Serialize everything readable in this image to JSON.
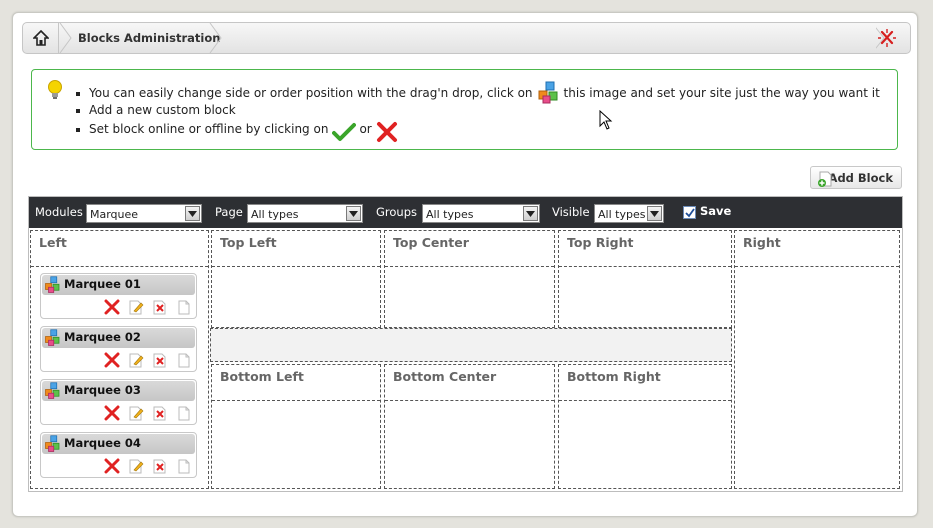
{
  "breadcrumb": {
    "title": "Blocks Administration",
    "home_icon": "home-icon",
    "close_icon": "close-icon"
  },
  "info": {
    "line1_a": "You can easily change side or order position with the drag'n drop, click on",
    "line1_b": "this image and set your site just the way you want it",
    "line2": "Add a new custom block",
    "line3_a": "Set block online or offline by clicking on",
    "line3_b": "or"
  },
  "toolbar": {
    "add_block_label": "Add Block"
  },
  "filters": {
    "modules_label": "Modules",
    "modules_value": "Marquee",
    "page_label": "Page",
    "page_value": "All types",
    "groups_label": "Groups",
    "groups_value": "All types",
    "visible_label": "Visible",
    "visible_value": "All types",
    "save_label": "Save",
    "save_checked": true
  },
  "zones": {
    "left": "Left",
    "top_left": "Top Left",
    "top_center": "Top Center",
    "top_right": "Top Right",
    "right": "Right",
    "bottom_left": "Bottom Left",
    "bottom_center": "Bottom Center",
    "bottom_right": "Bottom Right"
  },
  "blocks": [
    {
      "name": "Marquee 01"
    },
    {
      "name": "Marquee 02"
    },
    {
      "name": "Marquee 03"
    },
    {
      "name": "Marquee 04"
    }
  ],
  "colors": {
    "accent_green": "#4cb74c",
    "toolbar_dark": "#2d2f33",
    "delete_red": "#e02222"
  }
}
